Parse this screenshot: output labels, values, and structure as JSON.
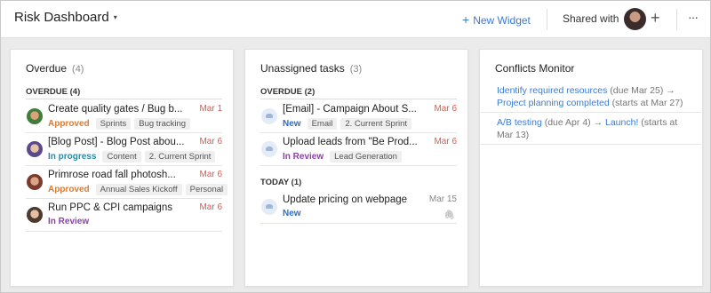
{
  "header": {
    "title": "Risk Dashboard",
    "caret_icon": "▾",
    "new_widget_icon": "+",
    "new_widget_label": "New Widget",
    "shared_label": "Shared with",
    "add_share_icon": "+",
    "more_icon": "···"
  },
  "overdue_panel": {
    "title": "Overdue",
    "count": "(4)",
    "group": "OVERDUE (4)",
    "tasks": [
      {
        "name": "Create quality gates / Bug b...",
        "date": "Mar 1",
        "status": "Approved",
        "tags": [
          "Sprints",
          "Bug tracking"
        ]
      },
      {
        "name": "[Blog Post] - Blog Post abou...",
        "date": "Mar 6",
        "status": "In progress",
        "tags": [
          "Content",
          "2. Current Sprint"
        ]
      },
      {
        "name": "Primrose road fall photosh...",
        "date": "Mar 6",
        "status": "Approved",
        "tags": [
          "Annual Sales Kickoff",
          "Personal"
        ]
      },
      {
        "name": "Run PPC & CPI campaigns",
        "date": "Mar 6",
        "status": "In Review",
        "tags": []
      }
    ]
  },
  "unassigned_panel": {
    "title": "Unassigned tasks",
    "count": "(3)",
    "group_overdue": "OVERDUE (2)",
    "group_today": "TODAY (1)",
    "tasks": [
      {
        "name": "[Email] - Campaign About S...",
        "date": "Mar 6",
        "status": "New",
        "tags": [
          "Email",
          "2. Current Sprint"
        ]
      },
      {
        "name": "Upload leads from \"Be Prod...",
        "date": "Mar 6",
        "status": "In Review",
        "tags": [
          "Lead Generation"
        ]
      },
      {
        "name": "Update pricing on webpage",
        "date": "Mar 15",
        "status": "New",
        "tags": [],
        "attachment_icon": "🖇"
      }
    ]
  },
  "conflicts_panel": {
    "title": "Conflicts Monitor",
    "items": [
      {
        "task": "Identify required resources",
        "due": "(due Mar 25)",
        "arrow": "→",
        "dep": "Project planning completed",
        "starts": "(starts at Mar 27)"
      },
      {
        "task": "A/B testing",
        "due": "(due Apr 4)",
        "arrow": "→",
        "dep": "Launch!",
        "starts": "(starts at Mar 13)"
      }
    ]
  },
  "colors": {
    "accent": "#3d7bd1",
    "overdue_date": "#e0584b",
    "approved": "#e07a2e",
    "in_progress": "#2a8aa6",
    "in_review": "#8d3fa8",
    "new": "#2b6fc7"
  }
}
